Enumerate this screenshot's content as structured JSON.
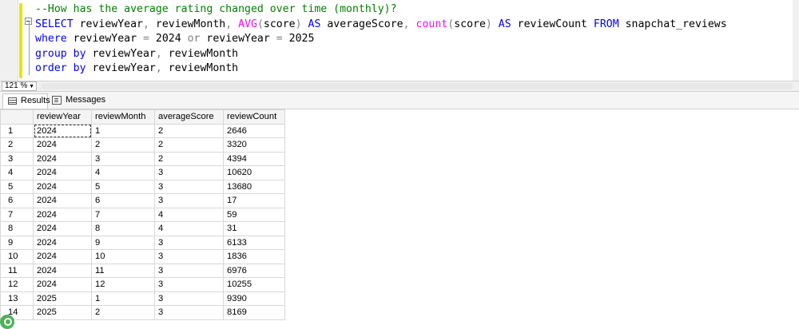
{
  "editor": {
    "lines": [
      [
        {
          "t": "--How has the average rating changed over time (monthly)?",
          "c": "cm"
        }
      ],
      [
        {
          "t": "SELECT",
          "c": "kw"
        },
        {
          "t": " reviewYear"
        },
        {
          "t": ",",
          "c": "op"
        },
        {
          "t": " reviewMonth"
        },
        {
          "t": ",",
          "c": "op"
        },
        {
          "t": " "
        },
        {
          "t": "AVG",
          "c": "fn"
        },
        {
          "t": "(",
          "c": "op"
        },
        {
          "t": "score"
        },
        {
          "t": ")",
          "c": "op"
        },
        {
          "t": " "
        },
        {
          "t": "AS",
          "c": "kw"
        },
        {
          "t": " averageScore"
        },
        {
          "t": ",",
          "c": "op"
        },
        {
          "t": " "
        },
        {
          "t": "count",
          "c": "fn"
        },
        {
          "t": "(",
          "c": "op"
        },
        {
          "t": "score"
        },
        {
          "t": ")",
          "c": "op"
        },
        {
          "t": " "
        },
        {
          "t": "AS",
          "c": "kw"
        },
        {
          "t": " reviewCount "
        },
        {
          "t": "FROM",
          "c": "kw"
        },
        {
          "t": " snapchat_reviews"
        }
      ],
      [
        {
          "t": "where",
          "c": "kw"
        },
        {
          "t": " reviewYear "
        },
        {
          "t": "=",
          "c": "op"
        },
        {
          "t": " 2024 "
        },
        {
          "t": "or",
          "c": "op"
        },
        {
          "t": " reviewYear "
        },
        {
          "t": "=",
          "c": "op"
        },
        {
          "t": " 2025"
        }
      ],
      [
        {
          "t": "group by",
          "c": "kw"
        },
        {
          "t": " reviewYear"
        },
        {
          "t": ",",
          "c": "op"
        },
        {
          "t": " reviewMonth"
        }
      ],
      [
        {
          "t": "order by",
          "c": "kw"
        },
        {
          "t": " reviewYear"
        },
        {
          "t": ",",
          "c": "op"
        },
        {
          "t": " reviewMonth"
        }
      ]
    ]
  },
  "zoom": {
    "value": "121 %"
  },
  "tabs": {
    "results": "Results",
    "messages": "Messages"
  },
  "grid": {
    "columns": [
      "reviewYear",
      "reviewMonth",
      "averageScore",
      "reviewCount"
    ],
    "rows": [
      [
        "1",
        "2024",
        "1",
        "2",
        "2646"
      ],
      [
        "2",
        "2024",
        "2",
        "2",
        "3320"
      ],
      [
        "3",
        "2024",
        "3",
        "2",
        "4394"
      ],
      [
        "4",
        "2024",
        "4",
        "3",
        "10620"
      ],
      [
        "5",
        "2024",
        "5",
        "3",
        "13680"
      ],
      [
        "6",
        "2024",
        "6",
        "3",
        "17"
      ],
      [
        "7",
        "2024",
        "7",
        "4",
        "59"
      ],
      [
        "8",
        "2024",
        "8",
        "4",
        "31"
      ],
      [
        "9",
        "2024",
        "9",
        "3",
        "6133"
      ],
      [
        "10",
        "2024",
        "10",
        "3",
        "1836"
      ],
      [
        "11",
        "2024",
        "11",
        "3",
        "6976"
      ],
      [
        "12",
        "2024",
        "12",
        "3",
        "10255"
      ],
      [
        "13",
        "2025",
        "1",
        "3",
        "9390"
      ],
      [
        "14",
        "2025",
        "2",
        "3",
        "8169"
      ]
    ]
  },
  "colors": {
    "keyword": "#0000ff",
    "function": "#ff00ff",
    "comment": "#008000",
    "operator": "#808080"
  }
}
